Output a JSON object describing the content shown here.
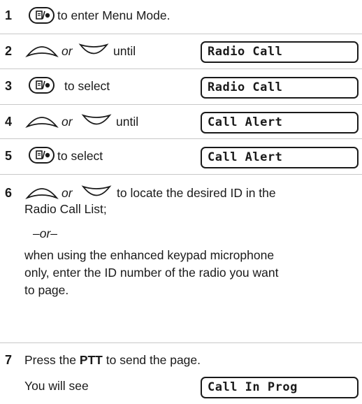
{
  "steps": {
    "s1": {
      "num": "1",
      "text": "to enter Menu Mode."
    },
    "s2": {
      "num": "2",
      "or": "or",
      "until": "until",
      "display": "Radio Call"
    },
    "s3": {
      "num": "3",
      "text": "to select",
      "display": "Radio Call"
    },
    "s4": {
      "num": "4",
      "or": "or",
      "until": "until",
      "display": "Call Alert"
    },
    "s5": {
      "num": "5",
      "text": "to select",
      "display": "Call Alert"
    },
    "s6": {
      "num": "6",
      "or": "or",
      "text_a": "to locate the desired ID in the",
      "text_b": "Radio Call List;",
      "alt": "–or–",
      "para_1": "when using the enhanced keypad microphone",
      "para_2": "only, enter the ID number of the radio you want",
      "para_3": "to page."
    },
    "s7": {
      "num": "7",
      "press": "Press the",
      "ptt": "PTT",
      "to_send": "to send the page.",
      "you_see": "You will see",
      "display": "Call In Prog"
    }
  },
  "icons": {
    "menu_select": "menu-select-button-icon",
    "scroll_up": "scroll-up-arrow-icon",
    "scroll_down": "scroll-down-arrow-icon"
  }
}
